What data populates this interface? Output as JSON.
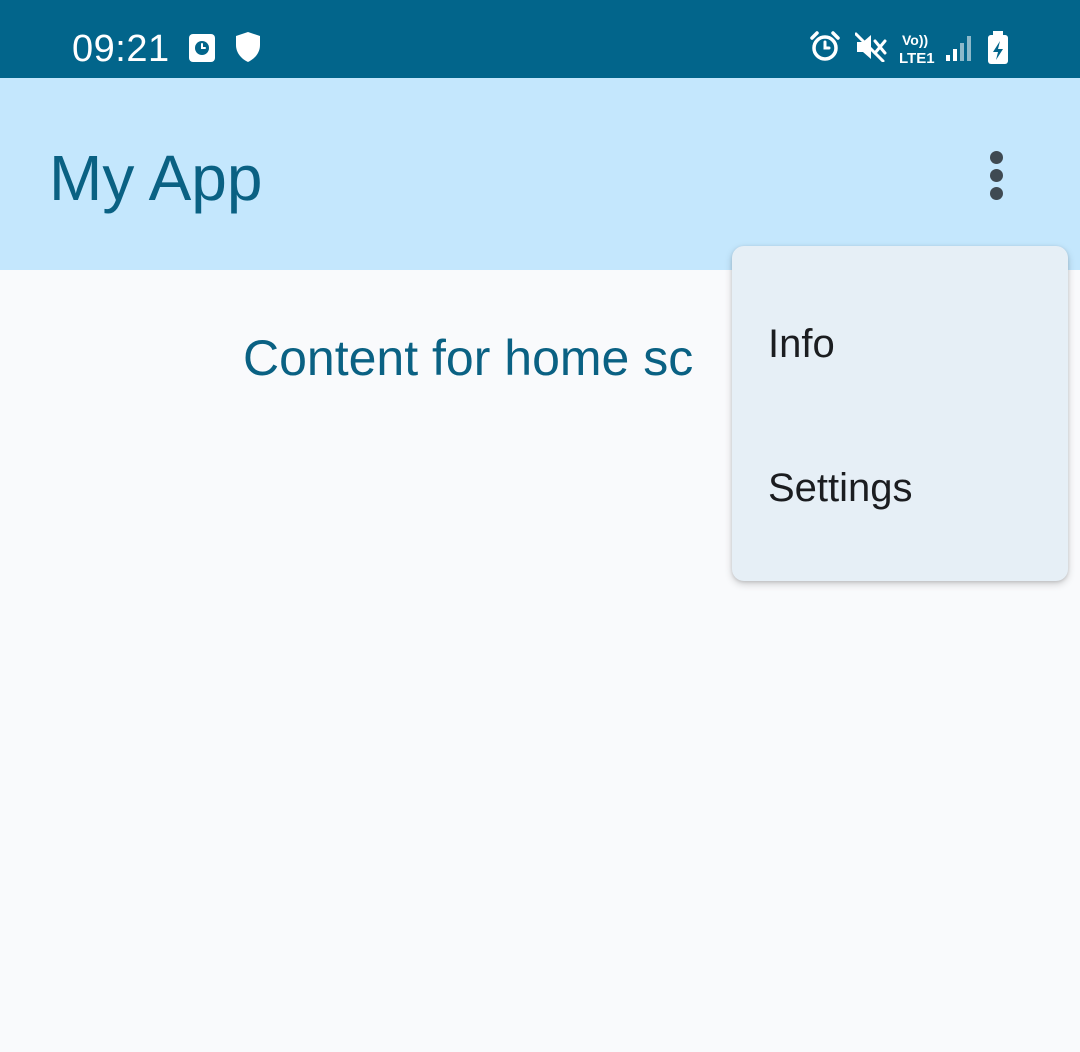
{
  "status_bar": {
    "time": "09:21",
    "left_icons": [
      "clock-app-icon",
      "shield-icon"
    ],
    "right_icons": [
      "alarm-icon",
      "mute-icon",
      "volte-lte-icon",
      "signal-icon",
      "battery-charging-icon"
    ],
    "volte_top": "Vo))",
    "volte_bottom": "LTE1",
    "color": "#02658b"
  },
  "app_bar": {
    "title": "My App",
    "overflow_icon": "more-vert-icon",
    "color": "#c4e7fd",
    "title_color": "#0a6183"
  },
  "content": {
    "text": "Content for home sc"
  },
  "menu": {
    "items": [
      {
        "label": "Info"
      },
      {
        "label": "Settings"
      }
    ],
    "background": "#e6eff6"
  }
}
